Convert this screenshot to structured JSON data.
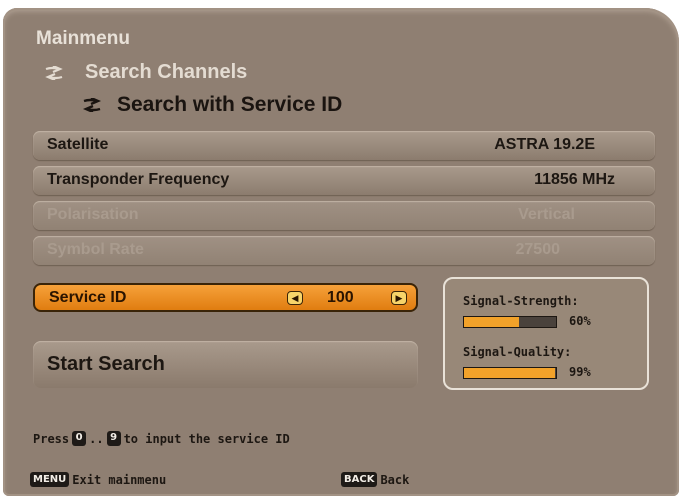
{
  "breadcrumb": {
    "main": "Mainmenu",
    "sub": "Search Channels",
    "current": "Search with Service ID"
  },
  "rows": {
    "satellite": {
      "label": "Satellite",
      "value": "ASTRA 19.2E"
    },
    "frequency": {
      "label": "Transponder Frequency",
      "value": "11856 MHz"
    },
    "polarisation": {
      "label": "Polarisation",
      "value": "Vertical"
    },
    "symbol_rate": {
      "label": "Symbol Rate",
      "value": "27500"
    }
  },
  "service_id": {
    "label": "Service ID",
    "value": "100"
  },
  "start_search": {
    "label": "Start Search"
  },
  "signal": {
    "strength_label": "Signal-Strength:",
    "strength_value": 60,
    "strength_text": "60%",
    "quality_label": "Signal-Quality:",
    "quality_value": 99,
    "quality_text": "99%"
  },
  "hint": {
    "prefix": "Press",
    "key_from": "0",
    "dots": "..",
    "key_to": "9",
    "suffix": "to input the service ID"
  },
  "footer": {
    "exit_key": "MENU",
    "exit_label": "Exit mainmenu",
    "back_key": "BACK",
    "back_label": "Back"
  },
  "colors": {
    "panel": "#8f7f72",
    "highlight": "#f29a2e",
    "bar_fill": "#f2a22a"
  }
}
